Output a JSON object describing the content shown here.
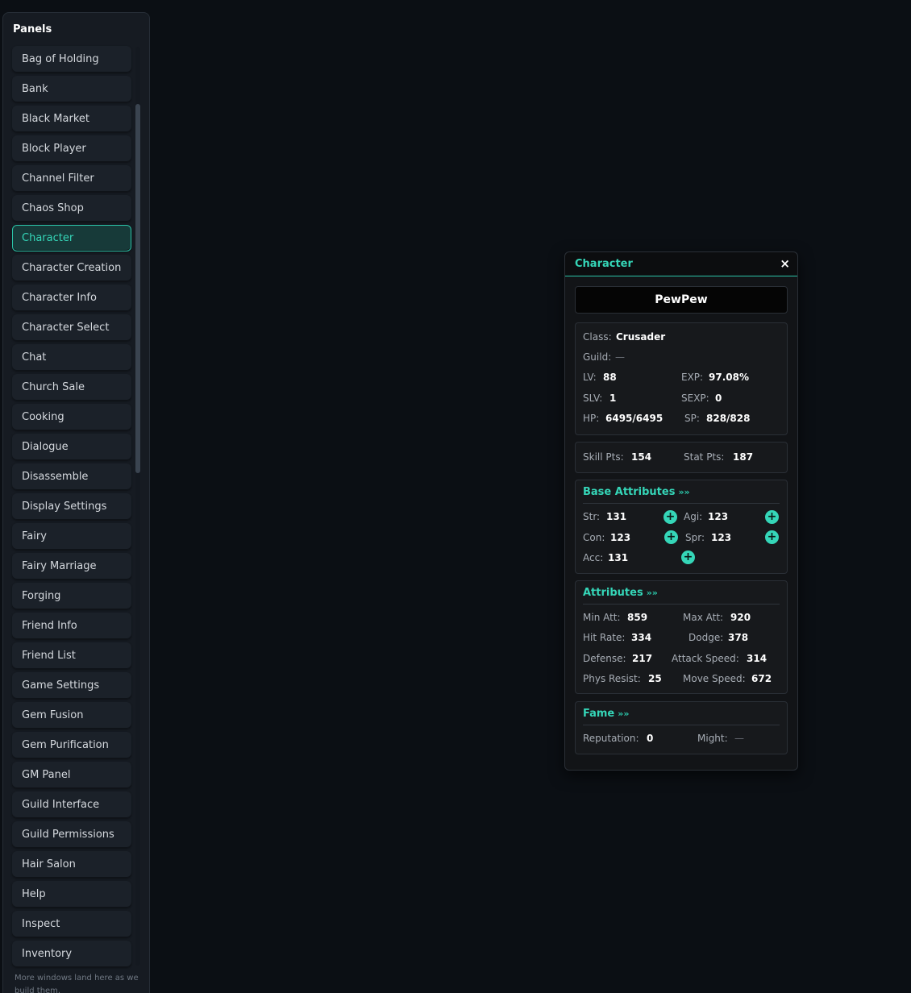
{
  "sidebar": {
    "title": "Panels",
    "items": [
      {
        "label": "Bag of Holding"
      },
      {
        "label": "Bank"
      },
      {
        "label": "Black Market"
      },
      {
        "label": "Block Player"
      },
      {
        "label": "Channel Filter"
      },
      {
        "label": "Chaos Shop"
      },
      {
        "label": "Character",
        "active": true
      },
      {
        "label": "Character Creation"
      },
      {
        "label": "Character Info"
      },
      {
        "label": "Character Select"
      },
      {
        "label": "Chat"
      },
      {
        "label": "Church Sale"
      },
      {
        "label": "Cooking"
      },
      {
        "label": "Dialogue"
      },
      {
        "label": "Disassemble"
      },
      {
        "label": "Display Settings"
      },
      {
        "label": "Fairy"
      },
      {
        "label": "Fairy Marriage"
      },
      {
        "label": "Forging"
      },
      {
        "label": "Friend Info"
      },
      {
        "label": "Friend List"
      },
      {
        "label": "Game Settings"
      },
      {
        "label": "Gem Fusion"
      },
      {
        "label": "Gem Purification"
      },
      {
        "label": "GM Panel"
      },
      {
        "label": "Guild Interface"
      },
      {
        "label": "Guild Permissions"
      },
      {
        "label": "Hair Salon"
      },
      {
        "label": "Help"
      },
      {
        "label": "Inspect"
      },
      {
        "label": "Inventory"
      }
    ],
    "footer": "More windows land here as we build them."
  },
  "character_window": {
    "title": "Character",
    "close_glyph": "×",
    "name": "PewPew",
    "info": {
      "class_label": "Class:",
      "class_value": "Crusader",
      "guild_label": "Guild:",
      "guild_value": "—",
      "lv_label": "LV:",
      "lv_value": "88",
      "exp_label": "EXP:",
      "exp_value": "97.08%",
      "slv_label": "SLV:",
      "slv_value": "1",
      "sexp_label": "SEXP:",
      "sexp_value": "0",
      "hp_label": "HP:",
      "hp_value": "6495/6495",
      "sp_label": "SP:",
      "sp_value": "828/828"
    },
    "points": {
      "skill_label": "Skill Pts:",
      "skill_value": "154",
      "stat_label": "Stat Pts:",
      "stat_value": "187"
    },
    "base_attributes": {
      "title": "Base Attributes",
      "str_label": "Str:",
      "str_value": "131",
      "agi_label": "Agi:",
      "agi_value": "123",
      "con_label": "Con:",
      "con_value": "123",
      "spr_label": "Spr:",
      "spr_value": "123",
      "acc_label": "Acc:",
      "acc_value": "131",
      "plus_glyph": "+"
    },
    "attributes": {
      "title": "Attributes",
      "min_att_label": "Min Att:",
      "min_att_value": "859",
      "max_att_label": "Max Att:",
      "max_att_value": "920",
      "hit_rate_label": "Hit Rate:",
      "hit_rate_value": "334",
      "dodge_label": "Dodge:",
      "dodge_value": "378",
      "defense_label": "Defense:",
      "defense_value": "217",
      "attack_speed_label": "Attack Speed:",
      "attack_speed_value": "314",
      "phys_resist_label": "Phys Resist:",
      "phys_resist_value": "25",
      "move_speed_label": "Move Speed:",
      "move_speed_value": "672"
    },
    "fame": {
      "title": "Fame",
      "reputation_label": "Reputation:",
      "reputation_value": "0",
      "might_label": "Might:",
      "might_value": "—"
    },
    "chevron_glyph": "»»"
  },
  "colors": {
    "accent": "#35d6b8",
    "background": "#0b0f14",
    "panel": "#161b22"
  }
}
